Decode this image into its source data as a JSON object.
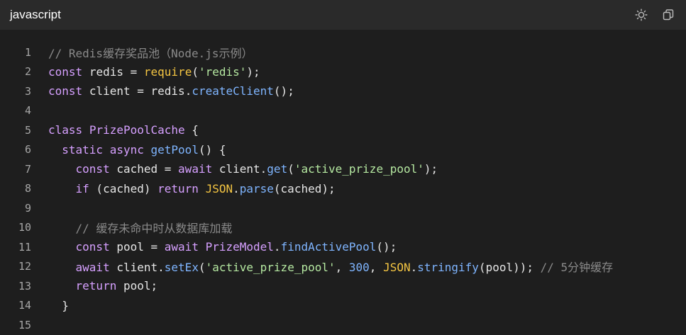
{
  "header": {
    "language": "javascript",
    "icons": [
      "sun-icon",
      "copy-icon"
    ]
  },
  "lines": [
    {
      "n": "1",
      "t": "// Redis缓存奖品池（Node.js示例）"
    },
    {
      "n": "2",
      "t": "const redis = require('redis');"
    },
    {
      "n": "3",
      "t": "const client = redis.createClient();"
    },
    {
      "n": "4",
      "t": ""
    },
    {
      "n": "5",
      "t": "class PrizePoolCache {"
    },
    {
      "n": "6",
      "t": "  static async getPool() {"
    },
    {
      "n": "7",
      "t": "    const cached = await client.get('active_prize_pool');"
    },
    {
      "n": "8",
      "t": "    if (cached) return JSON.parse(cached);"
    },
    {
      "n": "9",
      "t": ""
    },
    {
      "n": "10",
      "t": "    // 缓存未命中时从数据库加载"
    },
    {
      "n": "11",
      "t": "    const pool = await PrizeModel.findActivePool();"
    },
    {
      "n": "12",
      "t": "    await client.setEx('active_prize_pool', 300, JSON.stringify(pool)); // 5分钟缓存"
    },
    {
      "n": "13",
      "t": "    return pool;"
    },
    {
      "n": "14",
      "t": "  }"
    },
    {
      "n": "15",
      "t": ""
    }
  ]
}
